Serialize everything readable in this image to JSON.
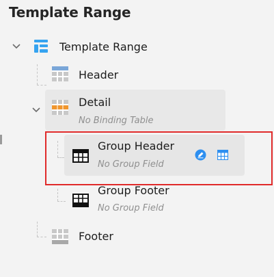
{
  "panel": {
    "title": "Template Range"
  },
  "tree": {
    "root": {
      "label": "Template Range",
      "icon": "template-range-icon"
    },
    "header": {
      "label": "Header",
      "icon": "header-table-icon"
    },
    "detail": {
      "label": "Detail",
      "sub": "No Binding Table",
      "icon": "detail-table-icon"
    },
    "group_header": {
      "label": "Group Header",
      "sub": "No Group Field",
      "icon": "group-header-icon",
      "actions": [
        "edit-icon",
        "table-settings-icon"
      ]
    },
    "group_footer": {
      "label": "Group Footer",
      "sub": "No Group Field",
      "icon": "group-footer-icon"
    },
    "footer": {
      "label": "Footer",
      "icon": "footer-table-icon"
    }
  },
  "colors": {
    "accent_blue": "#2d8ff0",
    "highlight_red": "#e02a2a",
    "detail_orange": "#f0962e",
    "header_blue": "#7aa6d8"
  }
}
